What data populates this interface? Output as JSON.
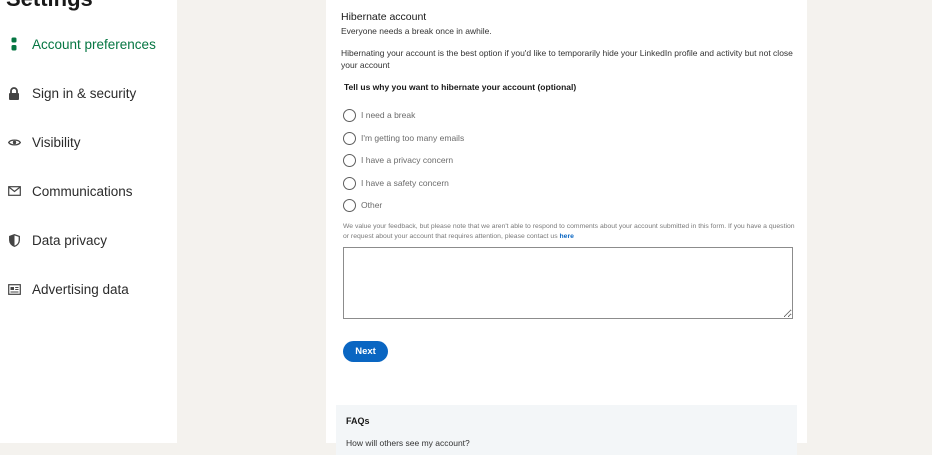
{
  "sidebar": {
    "title": "Settings",
    "items": [
      {
        "label": "Account preferences",
        "icon": "person-icon",
        "active": true
      },
      {
        "label": "Sign in & security",
        "icon": "lock-icon"
      },
      {
        "label": "Visibility",
        "icon": "eye-icon"
      },
      {
        "label": "Communications",
        "icon": "envelope-icon"
      },
      {
        "label": "Data privacy",
        "icon": "shield-icon"
      },
      {
        "label": "Advertising data",
        "icon": "newspaper-icon"
      }
    ]
  },
  "main": {
    "title": "Hibernate account",
    "subtitle": "Everyone needs a break once in awhile.",
    "description": "Hibernating your account is the best option if you'd like to temporarily hide your LinkedIn profile and activity but not close your account",
    "question": "Tell us why you want to hibernate your account (optional)",
    "options": [
      "I need a break",
      "I'm getting too many emails",
      "I have a privacy concern",
      "I have a safety concern",
      "Other"
    ],
    "note": "We value your feedback, but please note that we aren't able to respond to comments about your account submitted in this form. If you have a question or request about your account that requires attention, please contact us",
    "note_link": "here",
    "feedback_value": "",
    "next_label": "Next"
  },
  "faq": {
    "title": "FAQs",
    "question": "How will others see my account?"
  },
  "colors": {
    "active_green": "#057642",
    "brand_blue": "#0a66c2",
    "page_bg": "#f4f2ee"
  }
}
